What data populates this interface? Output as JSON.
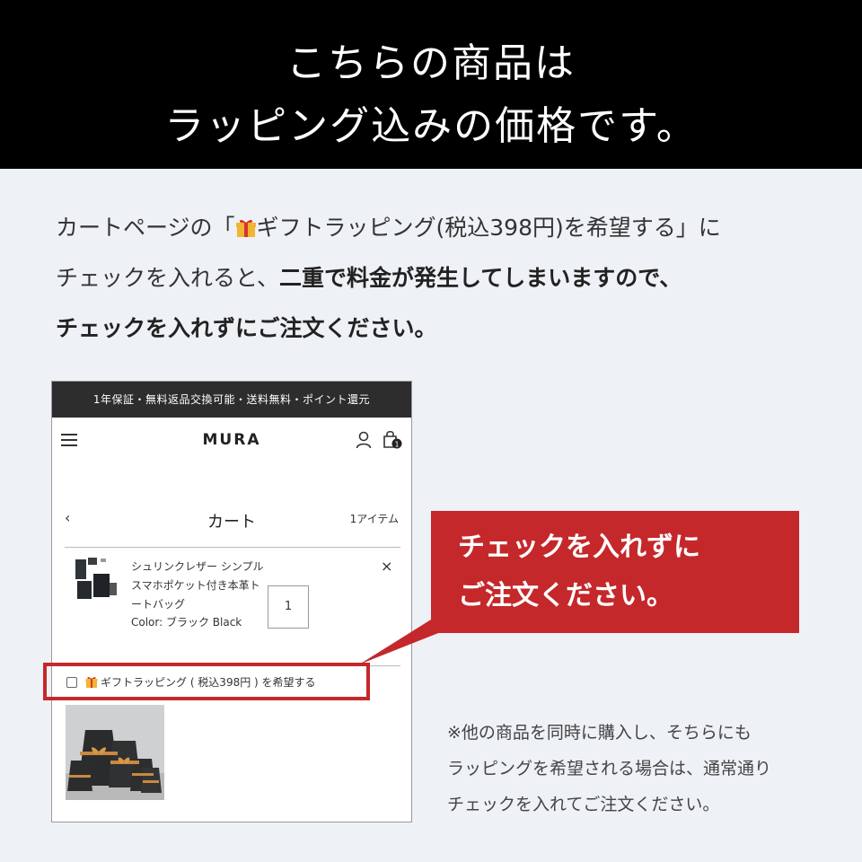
{
  "banner": {
    "line1": "こちらの商品は",
    "line2": "ラッピング込みの価格です。"
  },
  "intro": {
    "l1_pre": "カートページの「",
    "l1_post": "ギフトラッピング(税込398円)を希望する」に",
    "l2_pre": "チェックを入れると、",
    "l2_bold": "二重で料金が発生してしまいますので、",
    "l3_bold": "チェックを入れずにご注文ください。"
  },
  "phone": {
    "topbar": "1年保証・無料返品交換可能・送料無料・ポイント還元",
    "logo": "MURA",
    "cart_title": "カート",
    "cart_count": "1アイテム",
    "back": "‹",
    "close": "×",
    "cart_badge": "1",
    "item": {
      "name": "シュリンクレザー シンプル スマホポケット付き本革トートバッグ",
      "color": "Color: ブラック Black",
      "qty": "1"
    },
    "wrap_option": "ギフトラッピング ( 税込398円 ) を希望する"
  },
  "callout": {
    "line1": "チェックを入れずに",
    "line2": "ご注文ください。"
  },
  "note": {
    "line1": "※他の商品を同時に購入し、そちらにも",
    "line2": "ラッピングを希望される場合は、通常通り",
    "line3": "チェックを入れてご注文ください。"
  },
  "colors": {
    "accent_red": "#c4282b",
    "banner_bg": "#000000",
    "page_bg": "#eef1f5",
    "gift_yellow": "#f2b531",
    "gift_red": "#d9342b"
  },
  "icons": [
    "gift-icon",
    "hamburger-icon",
    "user-icon",
    "bag-icon",
    "back-icon",
    "close-icon",
    "checkbox-icon"
  ]
}
